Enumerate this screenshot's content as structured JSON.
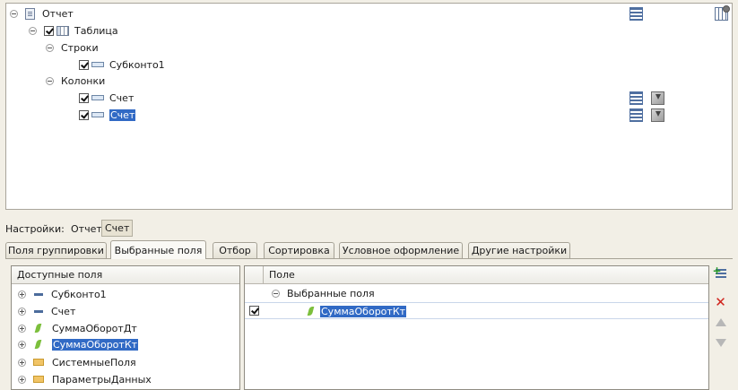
{
  "structure": {
    "root_label": "Отчет",
    "table_label": "Таблица",
    "rows_label": "Строки",
    "rows_field": "Субконто1",
    "columns_label": "Колонки",
    "columns_field_1": "Счет",
    "columns_field_2": "Счет"
  },
  "settings_bar": {
    "label": "Настройки:",
    "crumb_report": "Отчет",
    "crumb_account": "Счет"
  },
  "tabs": [
    {
      "label": "Поля группировки"
    },
    {
      "label": "Выбранные поля"
    },
    {
      "label": "Отбор"
    },
    {
      "label": "Сортировка"
    },
    {
      "label": "Условное оформление"
    },
    {
      "label": "Другие настройки"
    }
  ],
  "available_fields": {
    "header": "Доступные поля",
    "items": [
      {
        "label": "Субконто1",
        "icon": "field-icon"
      },
      {
        "label": "Счет",
        "icon": "field-icon"
      },
      {
        "label": "СуммаОборотДт",
        "icon": "resource-icon"
      },
      {
        "label": "СуммаОборотКт",
        "icon": "resource-icon"
      },
      {
        "label": "СистемныеПоля",
        "icon": "folder-icon"
      },
      {
        "label": "ПараметрыДанных",
        "icon": "folder-icon"
      }
    ]
  },
  "selected_fields": {
    "header": "Поле",
    "group_label": "Выбранные поля",
    "item_label": "СуммаОборотКт"
  },
  "colors": {
    "selection": "#316ac5",
    "window_bg": "#f2efe6",
    "delete_red": "#d0231c"
  }
}
